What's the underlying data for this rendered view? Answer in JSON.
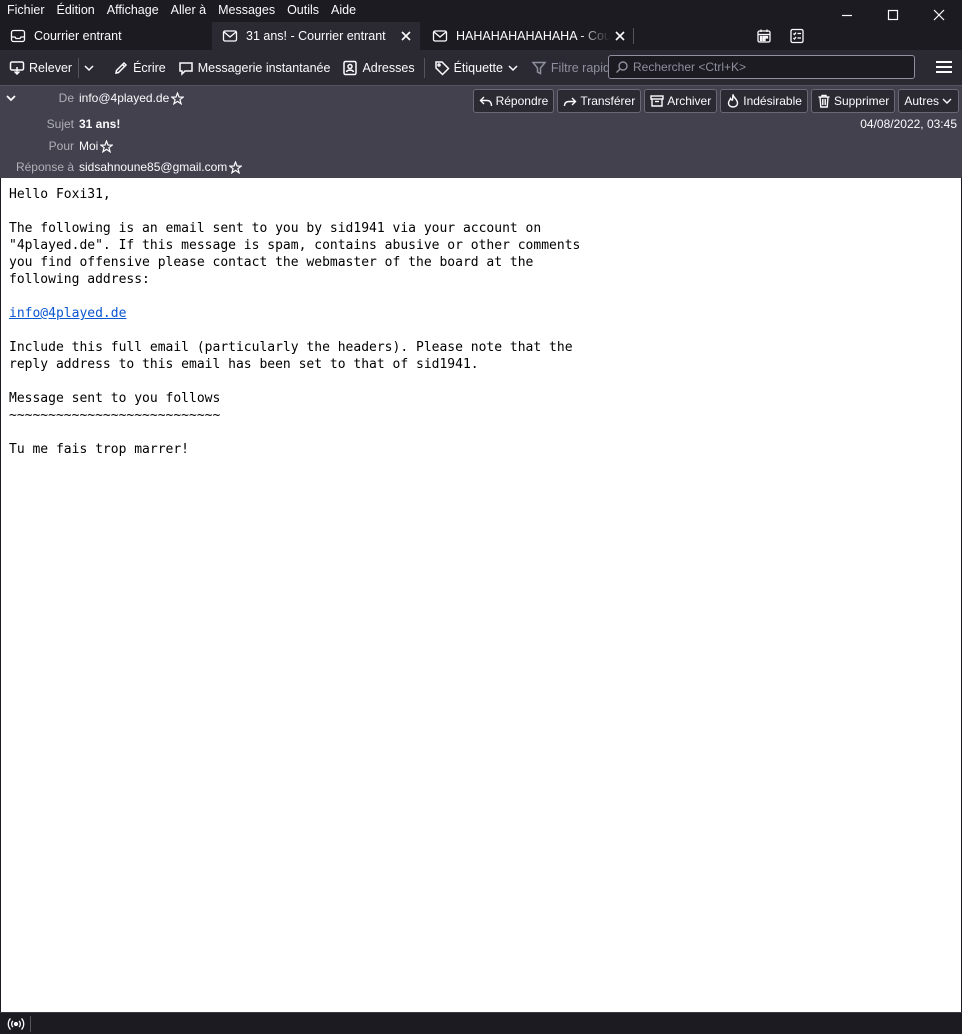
{
  "menubar": {
    "items": [
      {
        "label": "Fichier"
      },
      {
        "label": "Édition"
      },
      {
        "label": "Affichage"
      },
      {
        "label": "Aller à"
      },
      {
        "label": "Messages"
      },
      {
        "label": "Outils"
      },
      {
        "label": "Aide"
      }
    ]
  },
  "tabs": [
    {
      "label": "Courrier entrant",
      "icon": "inbox-icon",
      "active": false
    },
    {
      "label": "31 ans! - Courrier entrant",
      "icon": "envelope-icon",
      "active": true
    },
    {
      "label": "HAHAHAHAHAHAHA - Courrier entrant",
      "icon": "envelope-icon",
      "active": false
    }
  ],
  "toolbar": {
    "get_messages": "Relever",
    "write": "Écrire",
    "chat": "Messagerie instantanée",
    "address_book": "Adresses",
    "tag": "Étiquette",
    "quick_filter": "Filtre rapide",
    "search_placeholder": "Rechercher <Ctrl+K>"
  },
  "header": {
    "from_label": "De",
    "from_value": "info@4played.de",
    "subject_label": "Sujet",
    "subject_value": "31 ans!",
    "to_label": "Pour",
    "to_value": "Moi",
    "reply_to_label": "Réponse à",
    "reply_to_value": "sidsahnoune85@gmail.com",
    "date": "04/08/2022, 03:45",
    "actions": {
      "reply": "Répondre",
      "forward": "Transférer",
      "archive": "Archiver",
      "junk": "Indésirable",
      "delete": "Supprimer",
      "more": "Autres"
    }
  },
  "message": {
    "lines": [
      "Hello Foxi31,",
      "",
      "The following is an email sent to you by sid1941 via your account on",
      "\"4played.de\". If this message is spam, contains abusive or other comments",
      "you find offensive please contact the webmaster of the board at the",
      "following address:",
      "",
      "",
      "",
      "Include this full email (particularly the headers). Please note that the",
      "reply address to this email has been set to that of sid1941.",
      "",
      "Message sent to you follows",
      "~~~~~~~~~~~~~~~~~~~~~~~~~~~",
      "",
      "Tu me fais trop marrer!"
    ],
    "link": "info@4played.de"
  },
  "colors": {
    "accent": "#0b57d0",
    "chrome_dark": "#1c1b22",
    "toolbar": "#2b2a33",
    "header_pane": "#42414d"
  }
}
